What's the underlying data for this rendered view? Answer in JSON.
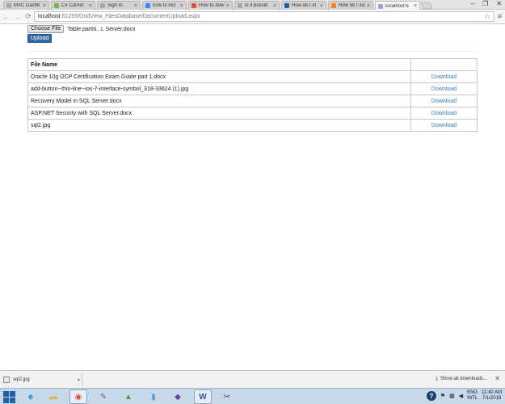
{
  "browser": {
    "tabs": [
      {
        "label": "MVC Dashb",
        "favicon_color": "#9aa9bd"
      },
      {
        "label": "C# Corner",
        "favicon_color": "#7fb24c"
      },
      {
        "label": "Sign In",
        "favicon_color": "#9aa9bd"
      },
      {
        "label": "how to incl",
        "favicon_color": "#4285f4"
      },
      {
        "label": "How to dow",
        "favicon_color": "#e94e3c"
      },
      {
        "label": "Is it possib",
        "favicon_color": "#9aa9bd"
      },
      {
        "label": "How do I in",
        "favicon_color": "#1f5fa8"
      },
      {
        "label": "How do I inc",
        "favicon_color": "#f48024"
      },
      {
        "label": "localhost:6",
        "favicon_color": "#9aa9bd"
      }
    ],
    "active_tab": 8,
    "window_controls": {
      "minimize": "–",
      "restore": "❐",
      "close": "✕"
    },
    "address": {
      "host": "localhost",
      "path": ":61293/GridView_FilesDatabase/DocumentUpload.aspx"
    },
    "icons": {
      "back": "back-arrow-icon",
      "forward": "forward-arrow-icon",
      "reload": "reload-icon",
      "star": "bookmark-star-icon",
      "menu": "menu-icon"
    }
  },
  "upload_form": {
    "choose_file_label": "Choose File",
    "chosen_file_text": "Table partiti...L Server.docx",
    "upload_button_label": "Upload"
  },
  "files_table": {
    "header": {
      "file_name": "File Name",
      "action": ""
    },
    "rows": [
      {
        "file_name": "Oracle 10g OCP Certification Exam Guide part 1.docx",
        "action": "Download"
      },
      {
        "file_name": "add-button--thin-line--ios-7-interface-symbol_318-33624 (1).jpg",
        "action": "Download"
      },
      {
        "file_name": "Recovery Model in SQL Server.docx",
        "action": "Download"
      },
      {
        "file_name": "ASP.NET Security with SQL Server.docx",
        "action": "Download"
      },
      {
        "file_name": "sql2.jpg",
        "action": "Download"
      }
    ],
    "link_color": "#337ab7"
  },
  "download_shelf": {
    "item_name": "sql2.jpg",
    "show_all_label": "Show all downloads...",
    "close": "✕"
  },
  "taskbar": {
    "apps": [
      {
        "name": "internet-explorer-icon",
        "glyph": "e",
        "color": "#1e73c8"
      },
      {
        "name": "file-explorer-icon",
        "glyph": "▬",
        "color": "#e0b44c"
      },
      {
        "name": "chrome-icon",
        "glyph": "◉",
        "color": "#d64b3a"
      },
      {
        "name": "paint-icon",
        "glyph": "✎",
        "color": "#8a4d9e"
      },
      {
        "name": "photo-viewer-icon",
        "glyph": "▲",
        "color": "#4e9a3a"
      },
      {
        "name": "notepad-icon",
        "glyph": "▮",
        "color": "#5ea1c9"
      },
      {
        "name": "visual-studio-icon",
        "glyph": "◆",
        "color": "#6a3fa0"
      },
      {
        "name": "word-icon",
        "glyph": "W",
        "color": "#2b579a"
      },
      {
        "name": "tools-icon",
        "glyph": "✂",
        "color": "#555555"
      }
    ],
    "tray": {
      "help": "?",
      "lang_top": "ENG",
      "lang_bottom": "INTL",
      "time": "11:40 AM",
      "date": "7/1/2016"
    }
  }
}
